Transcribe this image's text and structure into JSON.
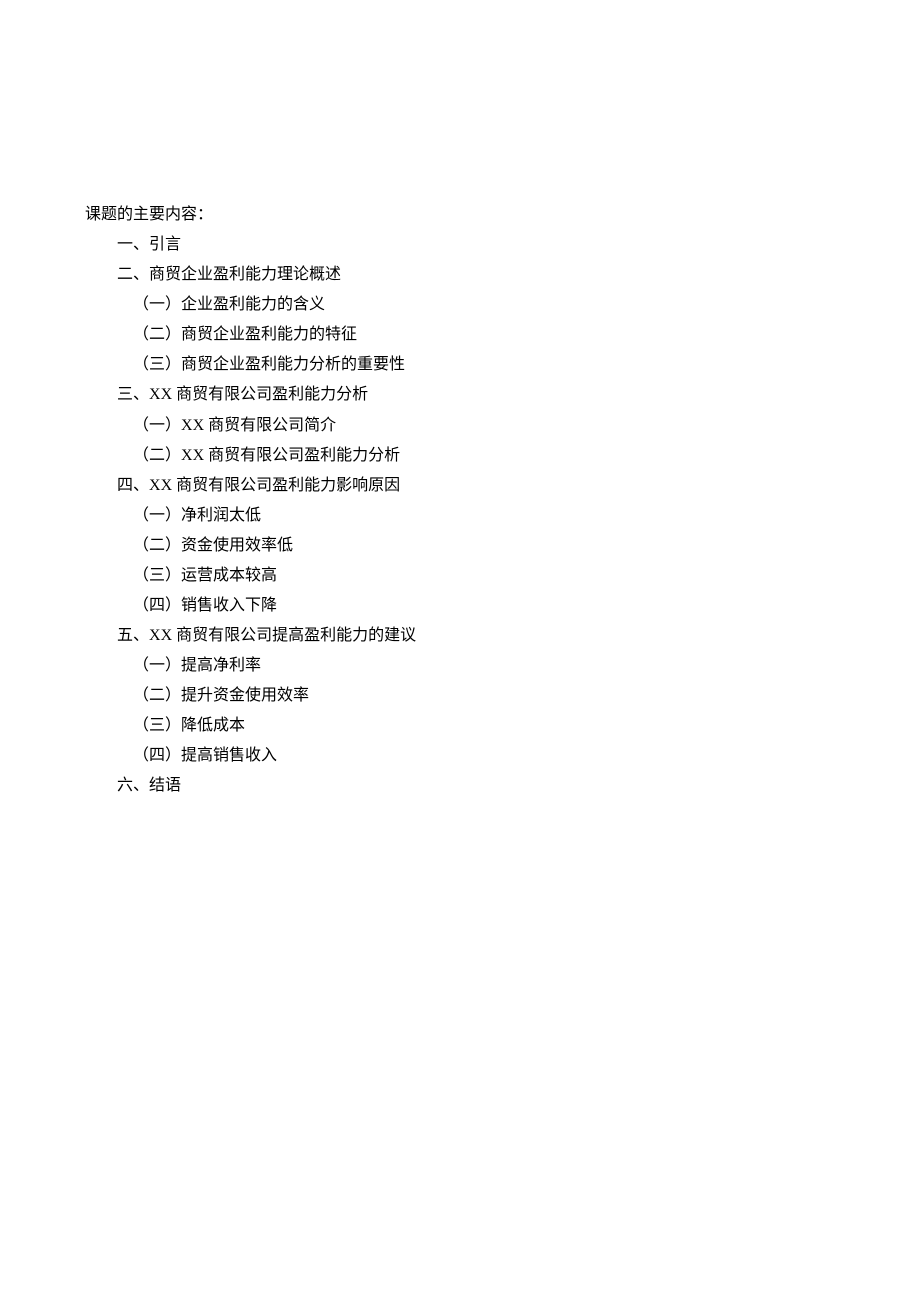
{
  "heading": "课题的主要内容：",
  "outline": [
    {
      "level": 1,
      "text": "一、引言"
    },
    {
      "level": 1,
      "text": "二、商贸企业盈利能力理论概述"
    },
    {
      "level": 2,
      "text": "（一）企业盈利能力的含义"
    },
    {
      "level": 2,
      "text": "（二）商贸企业盈利能力的特征"
    },
    {
      "level": 2,
      "text": "（三）商贸企业盈利能力分析的重要性"
    },
    {
      "level": 1,
      "text": "三、XX 商贸有限公司盈利能力分析"
    },
    {
      "level": 2,
      "text": "（一）XX 商贸有限公司简介"
    },
    {
      "level": 2,
      "text": "（二）XX 商贸有限公司盈利能力分析"
    },
    {
      "level": 1,
      "text": "四、XX 商贸有限公司盈利能力影响原因"
    },
    {
      "level": 2,
      "text": "（一）净利润太低"
    },
    {
      "level": 2,
      "text": "（二）资金使用效率低"
    },
    {
      "level": 2,
      "text": "（三）运营成本较高"
    },
    {
      "level": 2,
      "text": "（四）销售收入下降"
    },
    {
      "level": 1,
      "text": "五、XX 商贸有限公司提高盈利能力的建议"
    },
    {
      "level": 2,
      "text": "（一）提高净利率"
    },
    {
      "level": 2,
      "text": "（二）提升资金使用效率"
    },
    {
      "level": 2,
      "text": "（三）降低成本"
    },
    {
      "level": 2,
      "text": "（四）提高销售收入"
    },
    {
      "level": 1,
      "text": "六、结语"
    }
  ]
}
